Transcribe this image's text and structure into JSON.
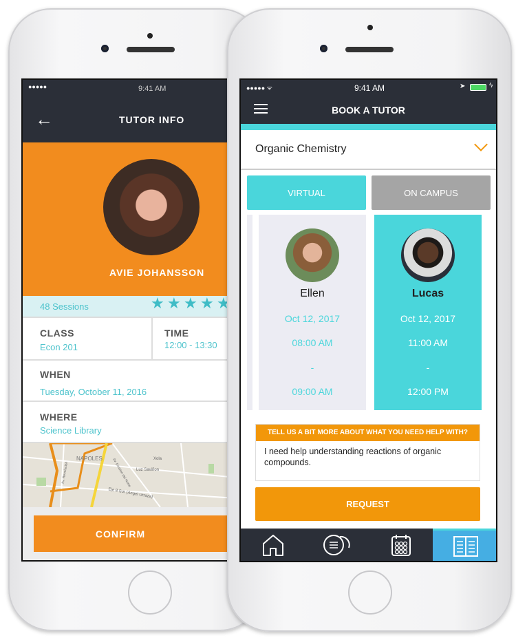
{
  "left_screen": {
    "status": {
      "time": "9:41 AM"
    },
    "header": {
      "title": "TUTOR INFO",
      "back_icon": "arrow-left-icon"
    },
    "tutor": {
      "name": "AVIE JOHANSSON",
      "sessions": "48 Sessions",
      "rating": 5
    },
    "class": {
      "label": "CLASS",
      "value": "Econ 201"
    },
    "time": {
      "label": "TIME",
      "value": "12:00 - 13:30"
    },
    "when": {
      "label": "WHEN",
      "value": "Tuesday, October 11, 2016"
    },
    "where": {
      "label": "WHERE",
      "value": "Science Library"
    },
    "map": {
      "labels": [
        "NAPOLES",
        "Av. Revolución",
        "Av. Division del Norte",
        "Luz Saviñon",
        "Xola",
        "Eje 8 Sur (Angel Urraza)"
      ]
    },
    "confirm_label": "CONFIRM"
  },
  "right_screen": {
    "status": {
      "time": "9:41 AM"
    },
    "header": {
      "title": "BOOK A TUTOR",
      "menu_icon": "hamburger-icon"
    },
    "subject": {
      "value": "Organic Chemistry"
    },
    "modes": {
      "virtual": "VIRTUAL",
      "campus": "ON CAMPUS",
      "selected": "VIRTUAL"
    },
    "tutors": [
      {
        "name": "Ellen",
        "date": "Oct 12, 2017",
        "start": "08:00 AM",
        "sep": "-",
        "end": "09:00 AM",
        "selected": false
      },
      {
        "name": "Lucas",
        "date": "Oct 12, 2017",
        "start": "11:00 AM",
        "sep": "-",
        "end": "12:00 PM",
        "selected": true
      }
    ],
    "help": {
      "title": "TELL US A BIT MORE ABOUT WHAT YOU NEED HELP WITH?",
      "value": "I need help understanding reactions of organic compounds."
    },
    "request_label": "REQUEST",
    "tabs": [
      {
        "icon": "home-icon"
      },
      {
        "icon": "chat-icon"
      },
      {
        "icon": "calendar-icon"
      },
      {
        "icon": "book-icon",
        "active": true
      }
    ]
  },
  "colors": {
    "orange": "#f28c1e",
    "teal": "#4ad6db",
    "dark": "#2b2f38",
    "active_tab": "#45aee3"
  }
}
